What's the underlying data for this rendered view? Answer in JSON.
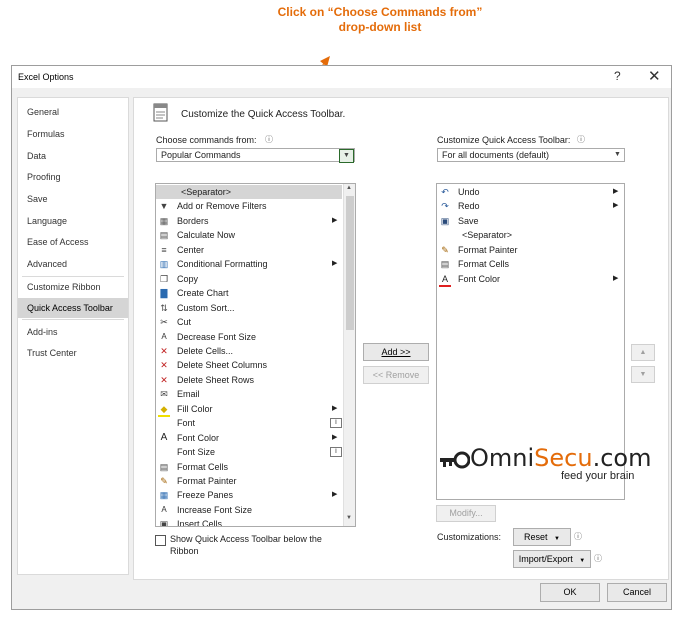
{
  "annotation": {
    "line1": "Click on “Choose Commands from”",
    "line2": "drop-down list"
  },
  "window": {
    "title": "Excel Options",
    "help": "?",
    "close": "✕"
  },
  "sidebar": {
    "items": [
      {
        "label": "General"
      },
      {
        "label": "Formulas"
      },
      {
        "label": "Data"
      },
      {
        "label": "Proofing"
      },
      {
        "label": "Save"
      },
      {
        "label": "Language"
      },
      {
        "label": "Ease of Access"
      },
      {
        "label": "Advanced"
      },
      {
        "label": "Customize Ribbon"
      },
      {
        "label": "Quick Access Toolbar"
      },
      {
        "label": "Add-ins"
      },
      {
        "label": "Trust Center"
      }
    ],
    "selected_index": 9
  },
  "main": {
    "heading": "Customize the Quick Access Toolbar.",
    "choose_label": "Choose commands from:",
    "choose_value": "Popular Commands",
    "qat_label": "Customize Quick Access Toolbar:",
    "qat_value": "For all documents (default)",
    "commands": [
      {
        "label": "<Separator>",
        "icon": "separator",
        "selected": true
      },
      {
        "label": "Add or Remove Filters",
        "icon": "filter-icon"
      },
      {
        "label": "Borders",
        "icon": "borders-icon",
        "submenu": true
      },
      {
        "label": "Calculate Now",
        "icon": "calculator-icon"
      },
      {
        "label": "Center",
        "icon": "align-center-icon"
      },
      {
        "label": "Conditional Formatting",
        "icon": "conditional-formatting-icon",
        "submenu": true
      },
      {
        "label": "Copy",
        "icon": "copy-icon"
      },
      {
        "label": "Create Chart",
        "icon": "chart-icon"
      },
      {
        "label": "Custom Sort...",
        "icon": "sort-icon"
      },
      {
        "label": "Cut",
        "icon": "scissors-icon"
      },
      {
        "label": "Decrease Font Size",
        "icon": "font-decrease-icon"
      },
      {
        "label": "Delete Cells...",
        "icon": "delete-cells-icon"
      },
      {
        "label": "Delete Sheet Columns",
        "icon": "delete-columns-icon"
      },
      {
        "label": "Delete Sheet Rows",
        "icon": "delete-rows-icon"
      },
      {
        "label": "Email",
        "icon": "email-icon"
      },
      {
        "label": "Fill Color",
        "icon": "fill-color-icon",
        "submenu": true
      },
      {
        "label": "Font",
        "icon": "none",
        "field": true
      },
      {
        "label": "Font Color",
        "icon": "font-color-icon",
        "submenu": true
      },
      {
        "label": "Font Size",
        "icon": "none",
        "field": true
      },
      {
        "label": "Format Cells",
        "icon": "format-cells-icon"
      },
      {
        "label": "Format Painter",
        "icon": "format-painter-icon"
      },
      {
        "label": "Freeze Panes",
        "icon": "freeze-panes-icon",
        "submenu": true
      },
      {
        "label": "Increase Font Size",
        "icon": "font-increase-icon"
      },
      {
        "label": "Insert Cells...",
        "icon": "insert-cells-icon"
      }
    ],
    "add_button": "Add >>",
    "remove_button": "<< Remove",
    "toolbar_items": [
      {
        "label": "Undo",
        "icon": "undo-icon",
        "submenu": true
      },
      {
        "label": "Redo",
        "icon": "redo-icon",
        "submenu": true
      },
      {
        "label": "Save",
        "icon": "save-icon"
      },
      {
        "label": "<Separator>",
        "icon": "separator"
      },
      {
        "label": "Format Painter",
        "icon": "format-painter-icon"
      },
      {
        "label": "Format Cells",
        "icon": "format-cells-icon"
      },
      {
        "label": "Font Color",
        "icon": "font-color-icon",
        "submenu": true
      }
    ],
    "modify_button": "Modify...",
    "customizations_label": "Customizations:",
    "reset_button": "Reset",
    "import_export_button": "Import/Export",
    "show_below_label_1": "Show Quick Access Toolbar below the",
    "show_below_label_2": "Ribbon"
  },
  "footer": {
    "ok": "OK",
    "cancel": "Cancel"
  },
  "watermark": {
    "brand": "OmniSecu.com",
    "tagline": "feed your brain"
  },
  "colors": {
    "accent": "#e46c0a",
    "selection": "#d5d5d5",
    "font_color_bar": "#e02020"
  }
}
